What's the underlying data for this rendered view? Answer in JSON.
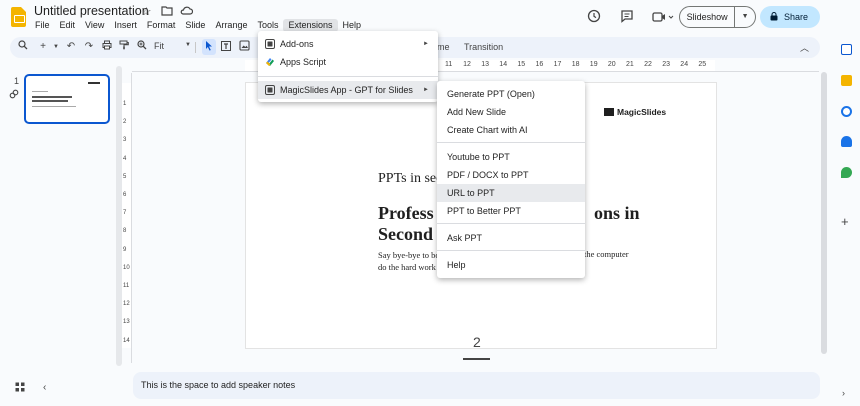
{
  "app": {
    "doc_title": "Untitled presentation",
    "menus": [
      "File",
      "Edit",
      "View",
      "Insert",
      "Format",
      "Slide",
      "Arrange",
      "Tools",
      "Extensions",
      "Help"
    ],
    "active_menu": "Extensions",
    "slideshow_label": "Slideshow",
    "share_label": "Share"
  },
  "toolbar": {
    "zoom": "Fit",
    "theme_label": "me",
    "transition_label": "Transition"
  },
  "ruler": {
    "top_labels": [
      "11",
      "12",
      "13",
      "14",
      "15",
      "16",
      "17",
      "18",
      "19",
      "20",
      "21",
      "22",
      "23",
      "24",
      "25"
    ],
    "left_labels": [
      "1",
      "2",
      "3",
      "4",
      "5",
      "6",
      "7",
      "8",
      "9",
      "10",
      "11",
      "12",
      "13",
      "14"
    ]
  },
  "filmstrip": {
    "slide_number": "1"
  },
  "slide": {
    "logo": "MagicSlides",
    "subtitle": "PPTs in sec",
    "heading_left": "Profess\nSecond",
    "heading_right": "ons in",
    "body_left": "Say bye-bye to bo\ndo the hard work",
    "body_right": "the computer"
  },
  "page_marker": "2",
  "notes": {
    "placeholder": "This is the space to add speaker notes"
  },
  "extensions_menu": {
    "items": [
      {
        "label": "Add-ons",
        "has_submenu": true
      },
      {
        "label": "Apps Script",
        "has_submenu": false
      },
      {
        "label": "MagicSlides App - GPT for Slides",
        "has_submenu": true
      }
    ]
  },
  "submenu": {
    "groups": [
      [
        "Generate PPT (Open)",
        "Add New Slide",
        "Create Chart with AI"
      ],
      [
        "Youtube to PPT",
        "PDF / DOCX to PPT",
        "URL to PPT",
        "PPT to Better PPT"
      ],
      [
        "Ask PPT"
      ],
      [
        "Help"
      ]
    ],
    "hovered": "URL to PPT"
  },
  "colors": {
    "accent": "#0b57d0",
    "share_bg": "#c2e7ff",
    "toolbar_bg": "#edf2fa"
  }
}
